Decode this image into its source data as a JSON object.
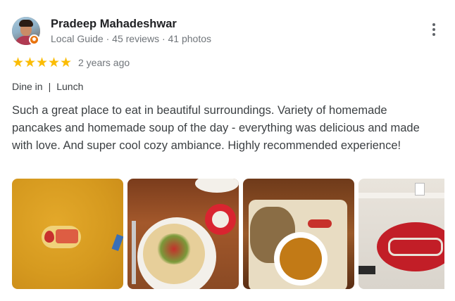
{
  "reviewer": {
    "name": "Pradeep Mahadeshwar",
    "meta": "Local Guide · 45 reviews · 41 photos",
    "badge_icon": "✹"
  },
  "review": {
    "rating": 5,
    "stars": [
      "★",
      "★",
      "★",
      "★",
      "★"
    ],
    "date": "2 years ago",
    "tags": [
      "Dine in",
      "Lunch"
    ],
    "tag_separator": "|",
    "text": "Such a great place to eat in beautiful surroundings. Variety of homemade pancakes and homemade soup of the day - everything was delicious and made with love. And super cool cozy ambiance. Highly recommended experience!"
  },
  "colors": {
    "star": "#fbbc04",
    "secondary_text": "#70757a",
    "badge": "#e8710a"
  }
}
